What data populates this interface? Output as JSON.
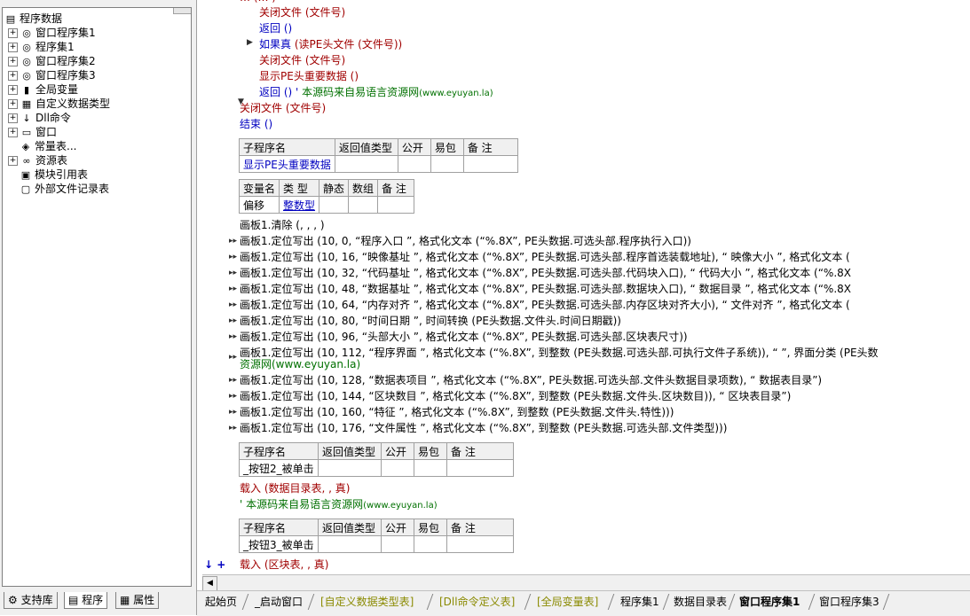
{
  "tree": {
    "root": "程序数据",
    "items": [
      {
        "label": "窗口程序集1",
        "icon": "assembly-icon"
      },
      {
        "label": "程序集1",
        "icon": "assembly-icon"
      },
      {
        "label": "窗口程序集2",
        "icon": "assembly-icon"
      },
      {
        "label": "窗口程序集3",
        "icon": "assembly-icon"
      },
      {
        "label": "全局变量",
        "icon": "global-var-icon"
      },
      {
        "label": "自定义数据类型",
        "icon": "datatype-icon"
      },
      {
        "label": "Dll命令",
        "icon": "dll-icon"
      },
      {
        "label": "窗口",
        "icon": "window-icon"
      },
      {
        "label": "常量表...",
        "icon": "constant-icon"
      },
      {
        "label": "资源表",
        "icon": "resource-icon"
      },
      {
        "label": "模块引用表",
        "icon": "module-icon"
      },
      {
        "label": "外部文件记录表",
        "icon": "file-icon"
      }
    ]
  },
  "left_tabs": [
    "支持库",
    "程序",
    "属性"
  ],
  "code": {
    "l1": "关闭文件 (文件号)",
    "l2": "返回 ()",
    "l3a": "如果真",
    "l3b": " (读PE头文件 (文件号))",
    "l4": "关闭文件 (文件号)",
    "l5": "显示PE头重要数据 ()",
    "l6a": "返回 ()  ' ",
    "l6b": "本源码来自易语言资源网",
    "l6c": "(www.eyuyan.la)",
    "l7": "关闭文件 (文件号)",
    "l8": "结束 ()",
    "sub1_headers": [
      "子程序名",
      "返回值类型",
      "公开",
      "易包",
      "备 注"
    ],
    "sub1_name": "显示PE头重要数据",
    "var_headers": [
      "变量名",
      "类 型",
      "静态",
      "数组",
      "备 注"
    ],
    "var_name": "偏移",
    "var_type": "整数型",
    "c0": "画板1.清除 (, , , )",
    "c1": "画板1.定位写出 (10, 0, “程序入口        ”, 格式化文本 (“%.8X”, PE头数据.可选头部.程序执行入口))",
    "c2": "画板1.定位写出 (10, 16, “映像基址        ”, 格式化文本 (“%.8X”, PE头数据.可选头部.程序首选装载地址), “  映像大小        ”, 格式化文本 (",
    "c3": "画板1.定位写出 (10, 32, “代码基址        ”, 格式化文本 (“%.8X”, PE头数据.可选头部.代码块入口), “  代码大小        ”, 格式化文本 (“%.8X",
    "c4": "画板1.定位写出 (10, 48, “数据基址        ”, 格式化文本 (“%.8X”, PE头数据.可选头部.数据块入口), “  数据目录        ”, 格式化文本 (“%.8X",
    "c5": "画板1.定位写出 (10, 64, “内存对齐        ”, 格式化文本 (“%.8X”, PE头数据.可选头部.内存区块对齐大小), “  文件对齐        ”, 格式化文本 (",
    "c6": "画板1.定位写出 (10, 80, “时间日期        ”, 时间转换 (PE头数据.文件头.时间日期戳))",
    "c7": "画板1.定位写出 (10, 96, “头部大小        ”, 格式化文本 (“%.8X”, PE头数据.可选头部.区块表尺寸))",
    "c8": "画板1.定位写出 (10, 112, “程序界面        ”, 格式化文本 (“%.8X”, 到整数 (PE头数据.可选头部.可执行文件子系统)), “  ”, 界面分类 (PE头数",
    "c8b": "资源网(www.eyuyan.la)",
    "c9": "画板1.定位写出 (10, 128, “数据表项目      ”, 格式化文本 (“%.8X”, PE头数据.可选头部.文件头数据目录项数), “                  数据表目录”)",
    "c10": "画板1.定位写出 (10, 144, “区块数目        ”, 格式化文本 (“%.8X”, 到整数 (PE头数据.文件头.区块数目)), “                  区块表目录”)",
    "c11": "画板1.定位写出 (10, 160, “特征            ”, 格式化文本 (“%.8X”, 到整数 (PE头数据.文件头.特性)))",
    "c12": "画板1.定位写出 (10, 176, “文件属性        ”, 格式化文本 (“%.8X”, 到整数 (PE头数据.可选头部.文件类型)))",
    "sub2_headers": [
      "子程序名",
      "返回值类型",
      "公开",
      "易包",
      "备 注"
    ],
    "sub2_name": "_按钮2_被单击",
    "l9": "载入 (数据目录表, , 真)",
    "l10a": "' 本源码来自易语言资源网",
    "l10b": "(www.eyuyan.la)",
    "sub3_headers": [
      "子程序名",
      "返回值类型",
      "公开",
      "易包",
      "备 注"
    ],
    "sub3_name": "_按钮3_被单击",
    "l11": "载入 (区块表, , 真)",
    "gutter_mark": "↓ +"
  },
  "bottom_tabs": [
    {
      "label": "起始页",
      "style": "normal"
    },
    {
      "label": "_启动窗口",
      "style": "normal"
    },
    {
      "label": "[自定义数据类型表]",
      "style": "dim"
    },
    {
      "label": "[Dll命令定义表]",
      "style": "dim"
    },
    {
      "label": "[全局变量表]",
      "style": "dim"
    },
    {
      "label": "程序集1",
      "style": "normal"
    },
    {
      "label": "数据目录表",
      "style": "normal"
    },
    {
      "label": "窗口程序集1",
      "style": "active"
    },
    {
      "label": "窗口程序集3",
      "style": "normal"
    }
  ]
}
